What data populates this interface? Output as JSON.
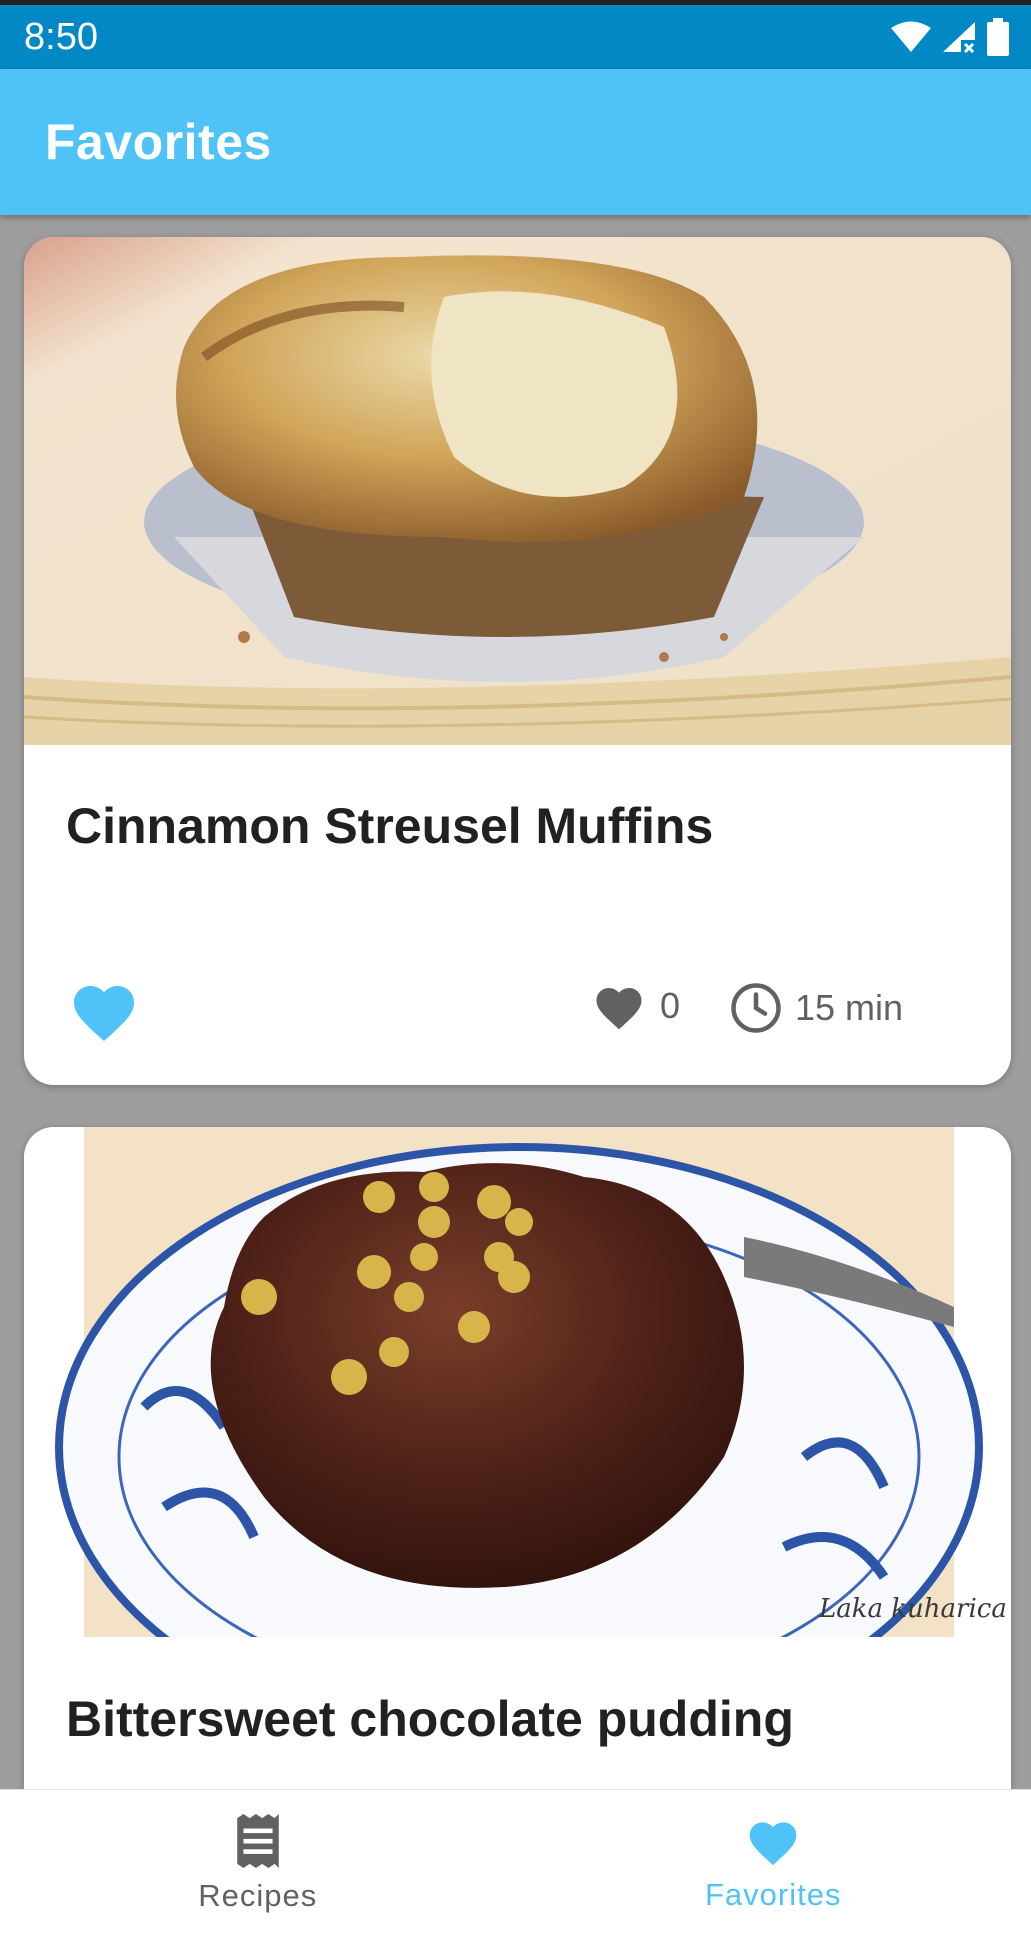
{
  "status_bar": {
    "time": "8:50"
  },
  "app_bar": {
    "title": "Favorites"
  },
  "recipes": [
    {
      "title": "Cinnamon Streusel Muffins",
      "likes": "0",
      "time": "15 min",
      "favorited": true
    },
    {
      "title": "Bittersweet chocolate pudding",
      "watermark": "Laka kuharica"
    }
  ],
  "bottom_nav": {
    "items": [
      {
        "label": "Recipes",
        "icon": "receipt-icon",
        "active": false
      },
      {
        "label": "Favorites",
        "icon": "heart-icon",
        "active": true
      }
    ]
  },
  "colors": {
    "status_bar": "#0288c4",
    "app_bar": "#4fc3f7",
    "accent": "#4fc3f7",
    "meta_gray": "#616161"
  }
}
